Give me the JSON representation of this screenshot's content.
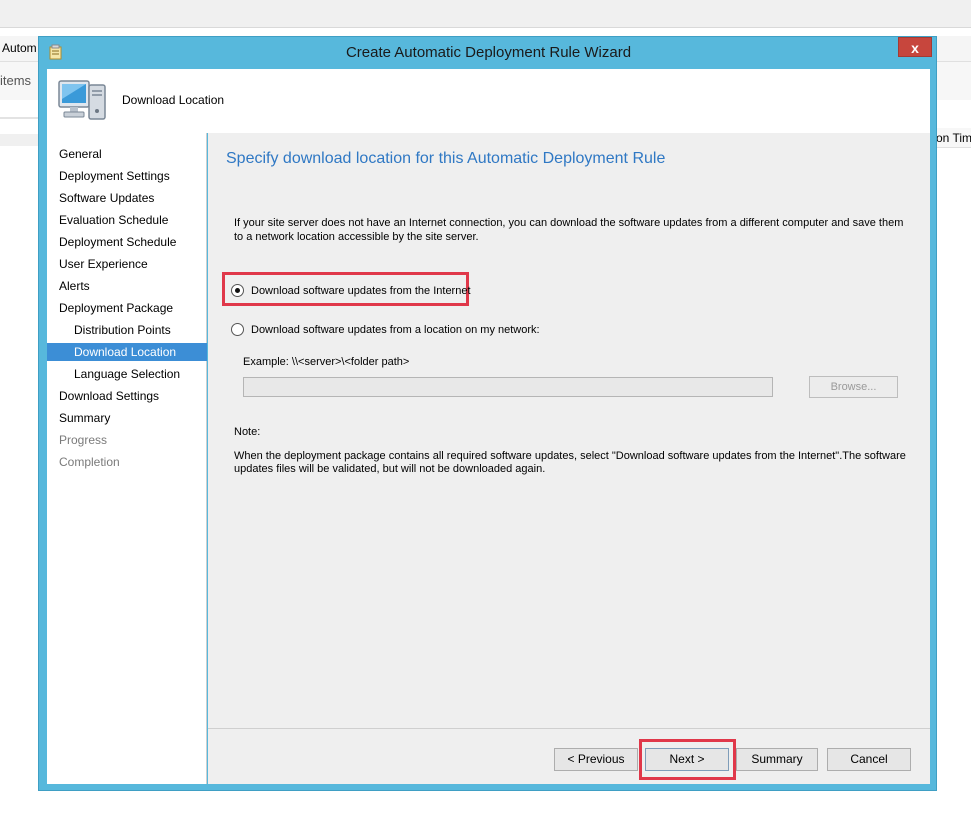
{
  "background": {
    "tab_label": "Autom",
    "items_label": "items",
    "column_header": "on Tim"
  },
  "window": {
    "title": "Create Automatic Deployment Rule Wizard",
    "close_glyph": "x",
    "icon": "wizard-icon"
  },
  "header": {
    "title": "Download Location",
    "icon": "computer-icon"
  },
  "nav": {
    "items": [
      {
        "label": "General",
        "state": "normal"
      },
      {
        "label": "Deployment Settings",
        "state": "normal"
      },
      {
        "label": "Software Updates",
        "state": "normal"
      },
      {
        "label": "Evaluation Schedule",
        "state": "normal"
      },
      {
        "label": "Deployment Schedule",
        "state": "normal"
      },
      {
        "label": "User Experience",
        "state": "normal"
      },
      {
        "label": "Alerts",
        "state": "normal"
      },
      {
        "label": "Deployment Package",
        "state": "normal"
      },
      {
        "label": "Distribution Points",
        "state": "sub"
      },
      {
        "label": "Download Location",
        "state": "active"
      },
      {
        "label": "Language Selection",
        "state": "sub"
      },
      {
        "label": "Download Settings",
        "state": "normal"
      },
      {
        "label": "Summary",
        "state": "normal"
      },
      {
        "label": "Progress",
        "state": "disabled"
      },
      {
        "label": "Completion",
        "state": "disabled"
      }
    ]
  },
  "content": {
    "heading": "Specify download location for this Automatic Deployment Rule",
    "description": "If your site server does not have an Internet connection, you can download the software updates from a different computer and save them to a network location accessible by the site server.",
    "option_internet": "Download software updates from the Internet",
    "option_network": "Download software updates from a location on my network:",
    "selected_option": "internet",
    "example_label": "Example: \\\\<server>\\<folder path>",
    "path_value": "",
    "browse_label": "Browse...",
    "note_label": "Note:",
    "note_text": "When the deployment package contains all required software updates, select \"Download  software updates from the Internet\".The software updates files will be validated, but will not be downloaded again."
  },
  "footer": {
    "previous_label": "< Previous",
    "next_label": "Next >",
    "summary_label": "Summary",
    "cancel_label": "Cancel"
  },
  "colors": {
    "frame": "#57b8dc",
    "accent": "#2f78c4",
    "highlight": "#e0384a",
    "active_nav": "#3c8ed6"
  }
}
